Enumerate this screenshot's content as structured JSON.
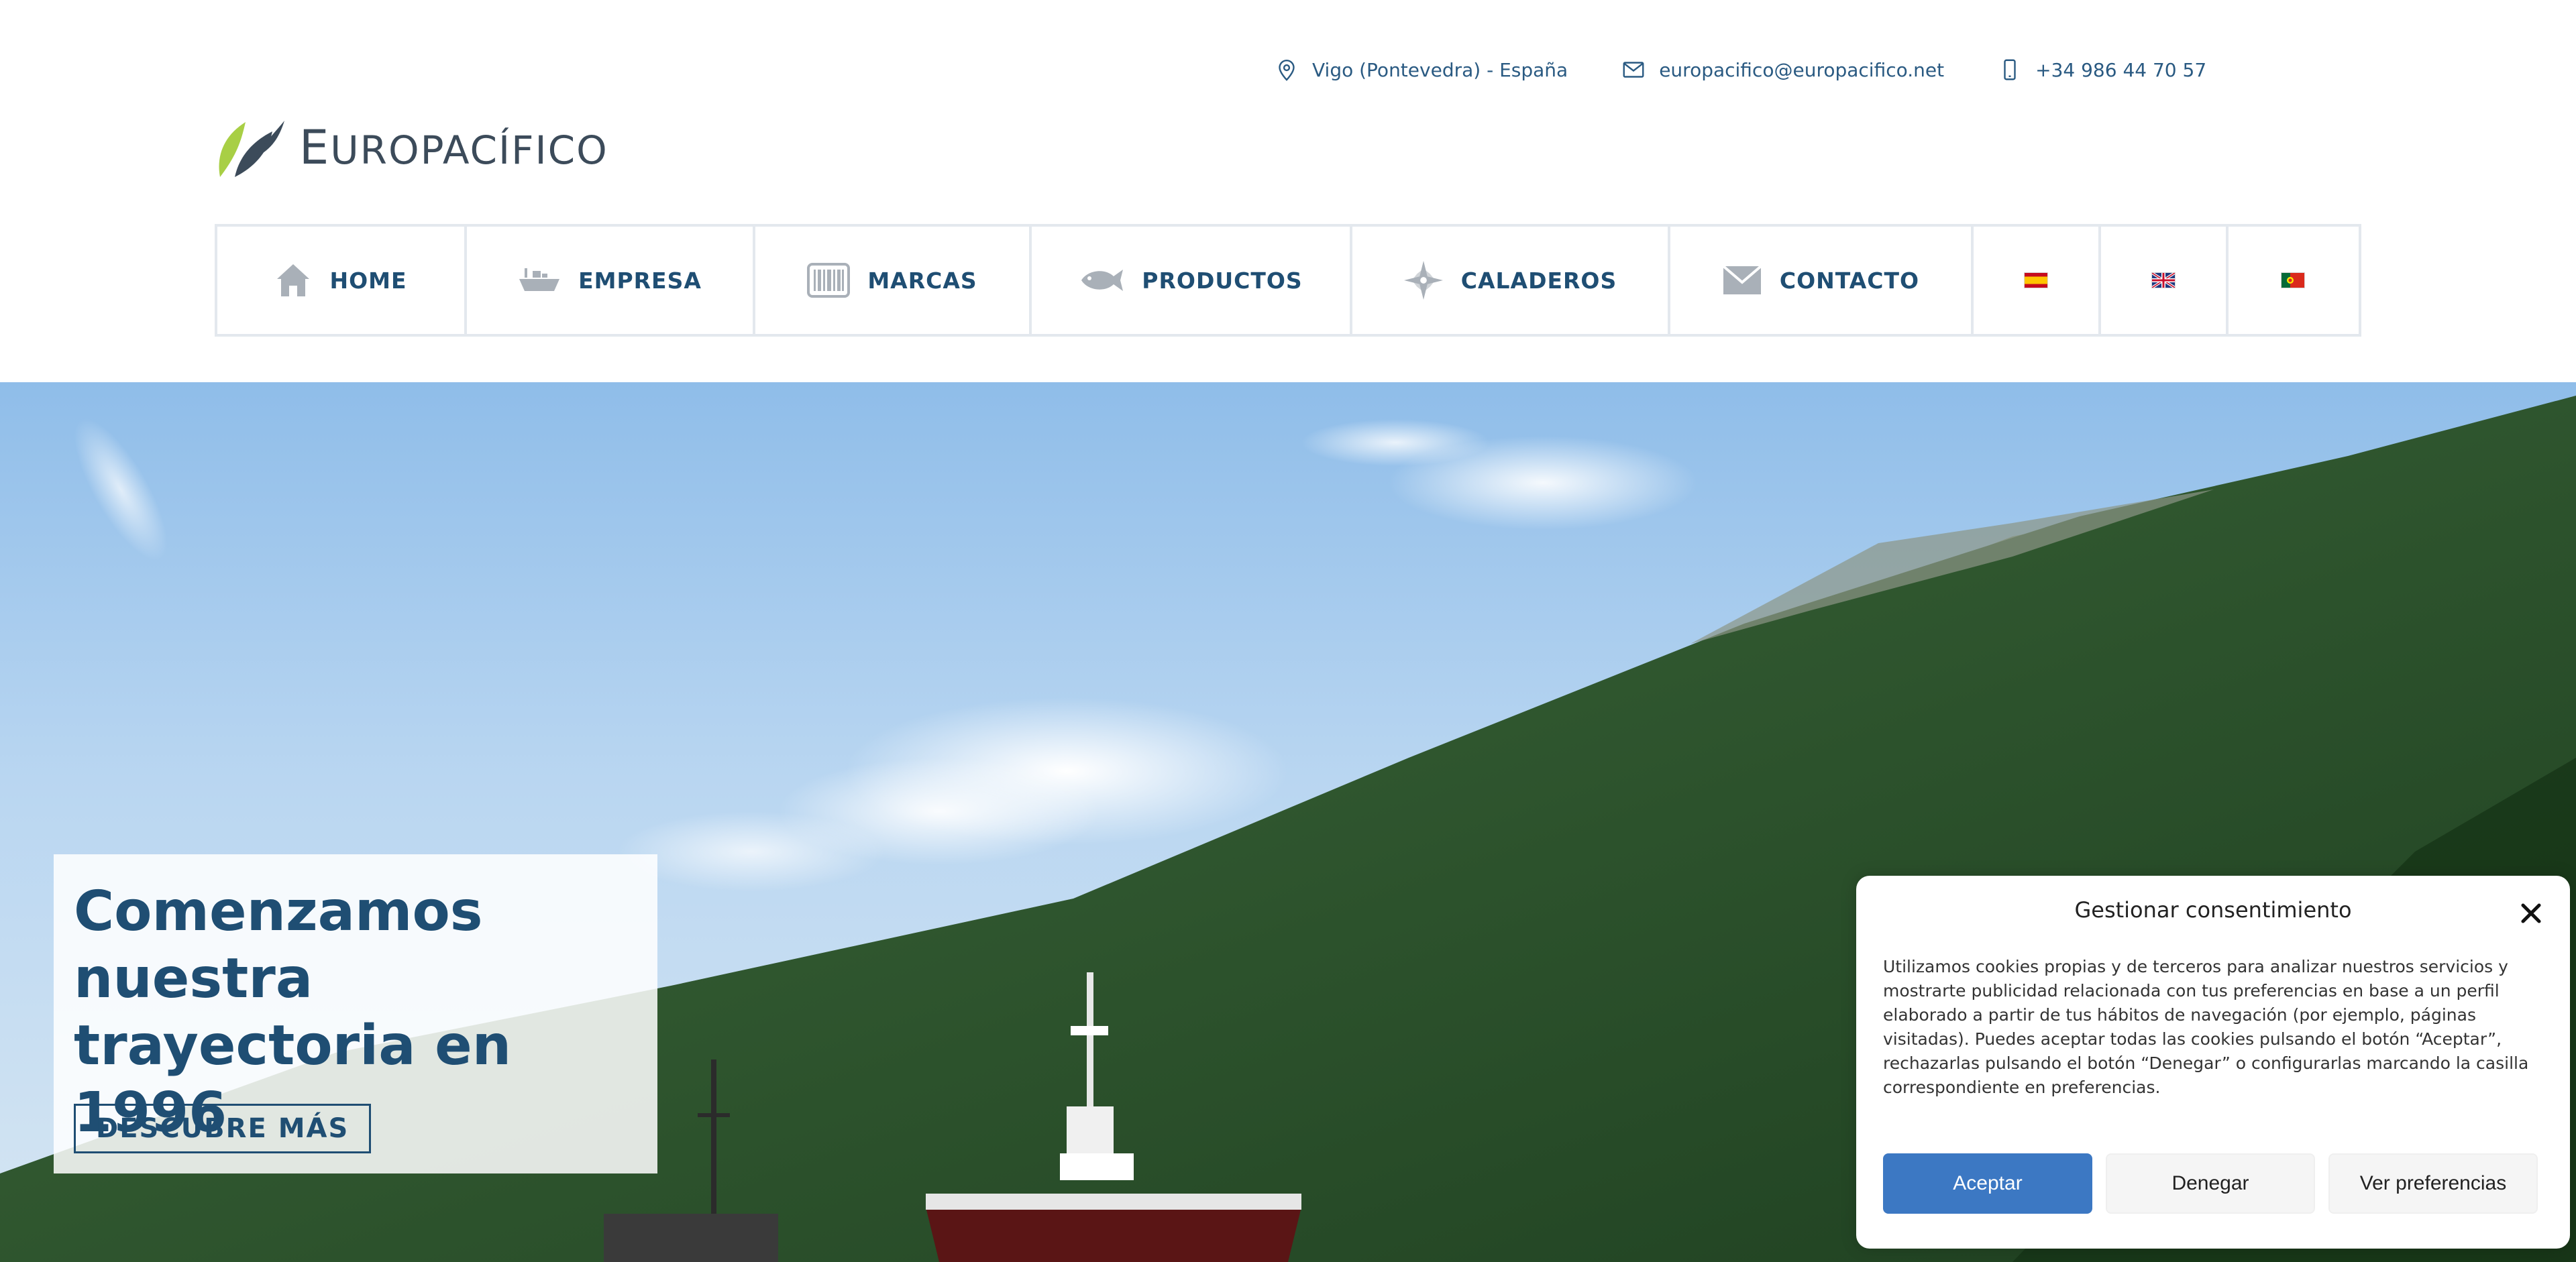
{
  "topbar": {
    "location": "Vigo (Pontevedra) - España",
    "email": "europacifico@europacifico.net",
    "phone": "+34 986 44 70 57"
  },
  "logo": {
    "text_cap": "E",
    "text_rest": "UROPACÍFICO"
  },
  "nav": {
    "items": [
      {
        "label": "HOME",
        "icon": "home-icon"
      },
      {
        "label": "EMPRESA",
        "icon": "ship-icon"
      },
      {
        "label": "MARCAS",
        "icon": "barcode-icon"
      },
      {
        "label": "PRODUCTOS",
        "icon": "fish-icon"
      },
      {
        "label": "CALADEROS",
        "icon": "compass-rose-icon"
      },
      {
        "label": "CONTACTO",
        "icon": "envelope-icon"
      }
    ],
    "languages": [
      "flag-es-icon",
      "flag-uk-icon",
      "flag-pt-icon"
    ]
  },
  "hero": {
    "title": "Comenzamos nuestra trayectoria en 1996",
    "button": "DESCUBRE MÁS"
  },
  "cookie": {
    "title": "Gestionar consentimiento",
    "text": "Utilizamos cookies propias y de terceros para analizar nuestros servicios y mostrarte publicidad relacionada con tus preferencias en base a un perfil elaborado a partir de tus hábitos de navegación (por ejemplo, páginas visitadas).  Puedes aceptar todas las cookies pulsando el botón “Aceptar”, rechazarlas pulsando el botón “Denegar” o configurarlas marcando la casilla correspondiente en preferencias.",
    "accept": "Aceptar",
    "deny": "Denegar",
    "preferences": "Ver preferencias"
  },
  "colors": {
    "primary": "#1f4e73",
    "accent_button": "#3c78c3",
    "logo_green": "#a8cf45",
    "logo_gray": "#3c4b5a"
  }
}
